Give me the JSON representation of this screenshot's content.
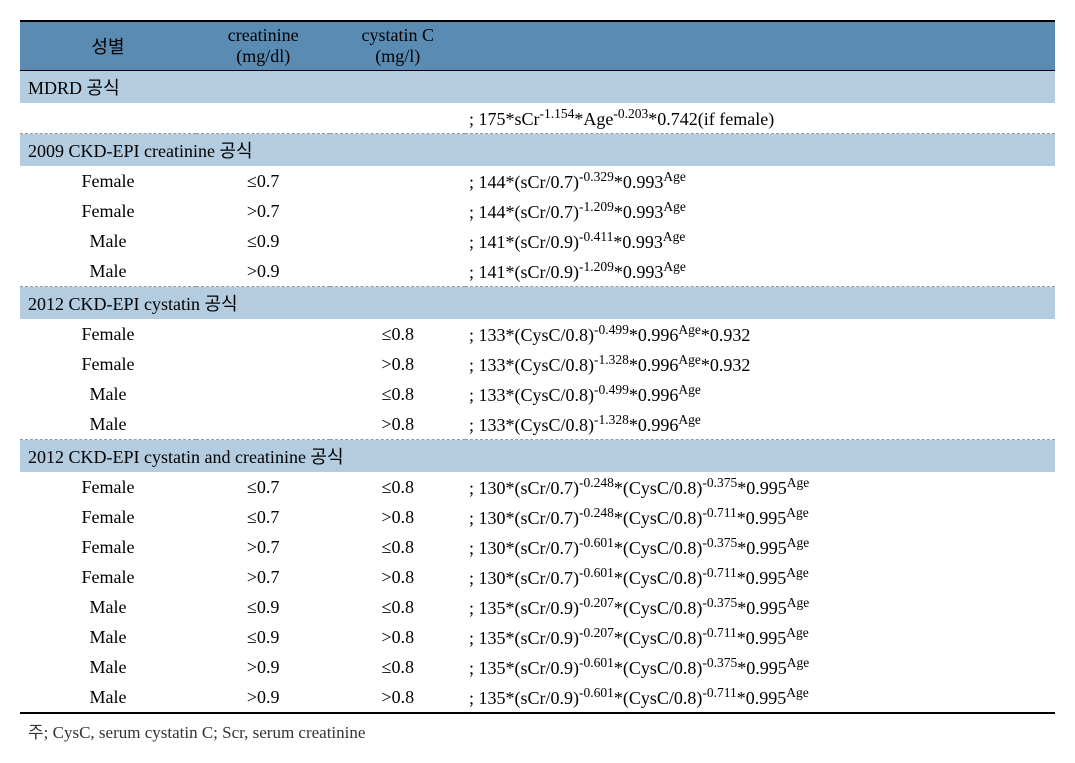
{
  "headers": {
    "col1": "성별",
    "col2_line1": "creatinine",
    "col2_line2": "(mg/dl)",
    "col3_line1": "cystatin C",
    "col3_line2": "(mg/l)"
  },
  "sections": [
    {
      "title": "MDRD 공식",
      "rows": [
        {
          "sex": "",
          "cr": "",
          "cys": "",
          "formula_html": "; 175*sCr<sup>-1.154</sup>*Age<sup>-0.203</sup>*0.742(if female)"
        }
      ]
    },
    {
      "title": "2009 CKD-EPI creatinine 공식",
      "rows": [
        {
          "sex": "Female",
          "cr": "≤0.7",
          "cys": "",
          "formula_html": "; 144*(sCr/0.7)<sup>-0.329</sup>*0.993<sup>Age</sup>"
        },
        {
          "sex": "Female",
          "cr": ">0.7",
          "cys": "",
          "formula_html": "; 144*(sCr/0.7)<sup>-1.209</sup>*0.993<sup>Age</sup>"
        },
        {
          "sex": "Male",
          "cr": "≤0.9",
          "cys": "",
          "formula_html": "; 141*(sCr/0.9)<sup>-0.411</sup>*0.993<sup>Age</sup>"
        },
        {
          "sex": "Male",
          "cr": ">0.9",
          "cys": "",
          "formula_html": "; 141*(sCr/0.9)<sup>-1.209</sup>*0.993<sup>Age</sup>"
        }
      ]
    },
    {
      "title": "2012 CKD-EPI cystatin 공식",
      "rows": [
        {
          "sex": "Female",
          "cr": "",
          "cys": "≤0.8",
          "formula_html": "; 133*(CysC/0.8)<sup>-0.499</sup>*0.996<sup>Age</sup>*0.932"
        },
        {
          "sex": "Female",
          "cr": "",
          "cys": ">0.8",
          "formula_html": "; 133*(CysC/0.8)<sup>-1.328</sup>*0.996<sup>Age</sup>*0.932"
        },
        {
          "sex": "Male",
          "cr": "",
          "cys": "≤0.8",
          "formula_html": "; 133*(CysC/0.8)<sup>-0.499</sup>*0.996<sup>Age</sup>"
        },
        {
          "sex": "Male",
          "cr": "",
          "cys": ">0.8",
          "formula_html": "; 133*(CysC/0.8)<sup>-1.328</sup>*0.996<sup>Age</sup>"
        }
      ]
    },
    {
      "title": "2012 CKD-EPI cystatin and creatinine 공식",
      "rows": [
        {
          "sex": "Female",
          "cr": "≤0.7",
          "cys": "≤0.8",
          "formula_html": "; 130*(sCr/0.7)<sup>-0.248</sup>*(CysC/0.8)<sup>-0.375</sup>*0.995<sup>Age</sup>"
        },
        {
          "sex": "Female",
          "cr": "≤0.7",
          "cys": ">0.8",
          "formula_html": "; 130*(sCr/0.7)<sup>-0.248</sup>*(CysC/0.8)<sup>-0.711</sup>*0.995<sup>Age</sup>"
        },
        {
          "sex": "Female",
          "cr": ">0.7",
          "cys": "≤0.8",
          "formula_html": "; 130*(sCr/0.7)<sup>-0.601</sup>*(CysC/0.8)<sup>-0.375</sup>*0.995<sup>Age</sup>"
        },
        {
          "sex": "Female",
          "cr": ">0.7",
          "cys": ">0.8",
          "formula_html": "; 130*(sCr/0.7)<sup>-0.601</sup>*(CysC/0.8)<sup>-0.711</sup>*0.995<sup>Age</sup>"
        },
        {
          "sex": "Male",
          "cr": "≤0.9",
          "cys": "≤0.8",
          "formula_html": "; 135*(sCr/0.9)<sup>-0.207</sup>*(CysC/0.8)<sup>-0.375</sup>*0.995<sup>Age</sup>"
        },
        {
          "sex": "Male",
          "cr": "≤0.9",
          "cys": ">0.8",
          "formula_html": "; 135*(sCr/0.9)<sup>-0.207</sup>*(CysC/0.8)<sup>-0.711</sup>*0.995<sup>Age</sup>"
        },
        {
          "sex": "Male",
          "cr": ">0.9",
          "cys": "≤0.8",
          "formula_html": "; 135*(sCr/0.9)<sup>-0.601</sup>*(CysC/0.8)<sup>-0.375</sup>*0.995<sup>Age</sup>"
        },
        {
          "sex": "Male",
          "cr": ">0.9",
          "cys": ">0.8",
          "formula_html": "; 135*(sCr/0.9)<sup>-0.601</sup>*(CysC/0.8)<sup>-0.711</sup>*0.995<sup>Age</sup>"
        }
      ]
    }
  ],
  "footnote": "주; CysC, serum cystatin C; Scr, serum creatinine"
}
